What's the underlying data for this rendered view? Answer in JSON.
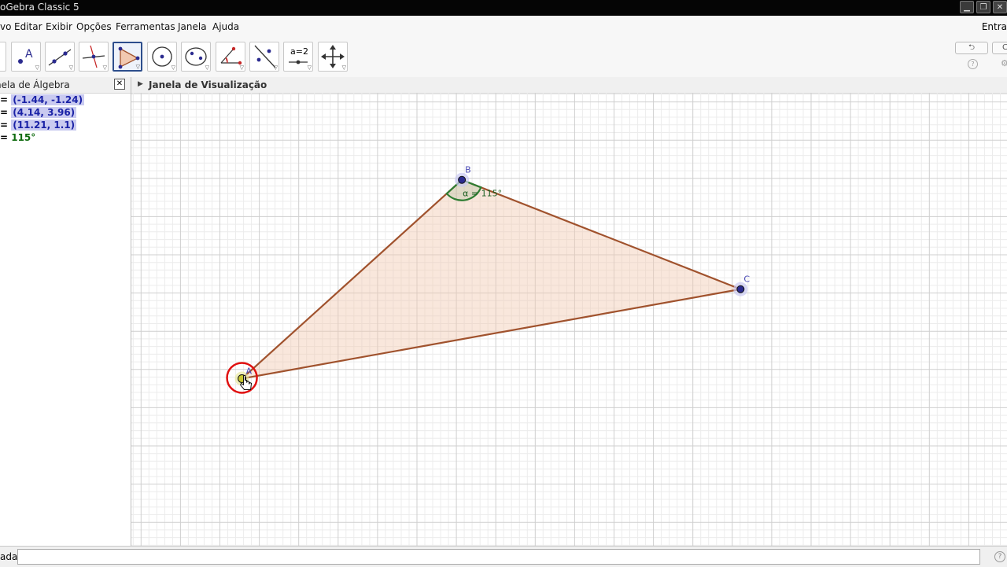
{
  "window": {
    "title": "oGebra Classic 5"
  },
  "menu": {
    "items": [
      "vo",
      "Editar",
      "Exibir",
      "Opções",
      "Ferramentas",
      "Janela",
      "Ajuda"
    ],
    "signin": "Entra"
  },
  "toolbar": {
    "selected_tool": "polygon",
    "tool_sliders_label": "a=2"
  },
  "algebra": {
    "title": "nela de Álgebra",
    "rows": [
      {
        "prefix": "= ",
        "value": "(-1.44, -1.24)"
      },
      {
        "prefix": "= ",
        "value": "(4.14, 3.96)"
      },
      {
        "prefix": "= ",
        "value": "(11.21, 1.1)"
      },
      {
        "prefix": "= ",
        "value": "115°"
      }
    ]
  },
  "graphics": {
    "title": "Janela de Visualização",
    "points": [
      {
        "name": "A",
        "x": -1.44,
        "y": -1.24
      },
      {
        "name": "B",
        "x": 4.14,
        "y": 3.96
      },
      {
        "name": "C",
        "x": 11.21,
        "y": 1.1
      }
    ],
    "angle_label": "α = 115°",
    "polygon_fill": "#f2c9b1",
    "polygon_stroke": "#a0522d",
    "point_color": "#2b2b8f",
    "angle_color": "#2e7d32",
    "selected_point_color": "#c8c832"
  },
  "inputbar": {
    "label": "ada:",
    "value": ""
  }
}
